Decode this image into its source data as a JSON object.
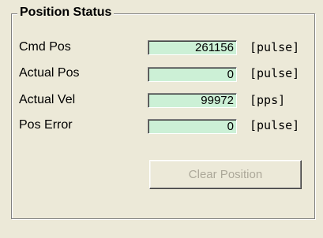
{
  "group": {
    "title": "Position Status"
  },
  "rows": [
    {
      "label": "Cmd Pos",
      "value": "261156",
      "unit": "[pulse]"
    },
    {
      "label": "Actual Pos",
      "value": "0",
      "unit": "[pulse]"
    },
    {
      "label": "Actual Vel",
      "value": "99972",
      "unit": "[pps]"
    },
    {
      "label": "Pos Error",
      "value": "0",
      "unit": "[pulse]"
    }
  ],
  "actions": {
    "clear_label": "Clear Position"
  },
  "colors": {
    "field_background": "#ccf0d6",
    "disabled_text": "#aca899",
    "window_background": "#ece9d8"
  }
}
